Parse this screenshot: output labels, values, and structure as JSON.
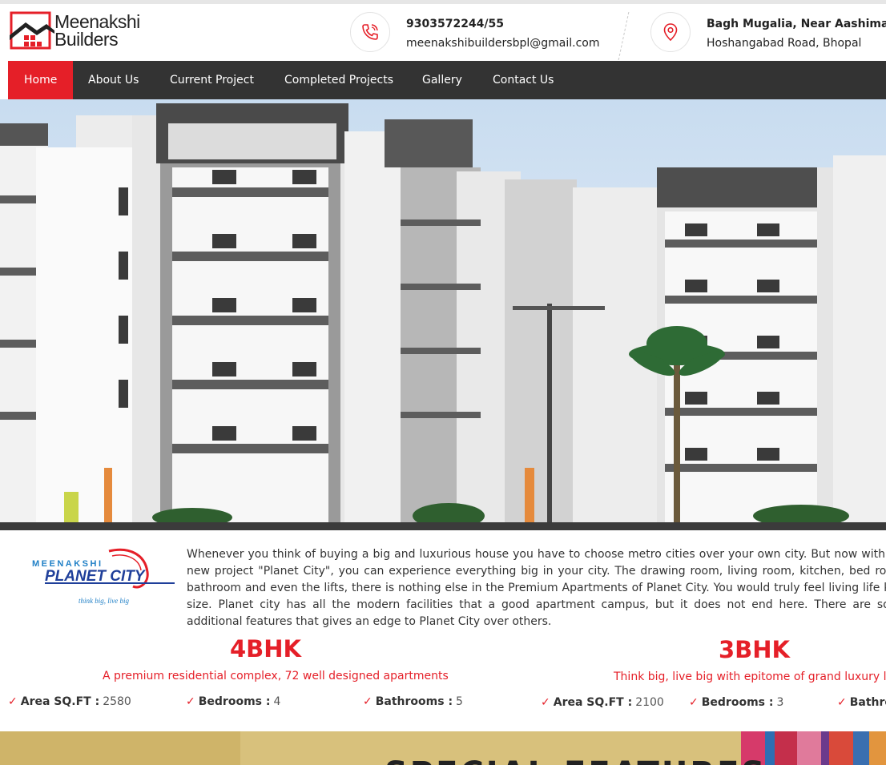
{
  "brand": {
    "name_line1": "Meenakshi",
    "name_line2": "Builders"
  },
  "contact": {
    "phone": "9303572244/55",
    "email": "meenakshibuildersbpl@gmail.com",
    "address_line1": "Bagh Mugalia, Near Aashima M",
    "address_line2": "Hoshangabad Road, Bhopal",
    "phone_icon": "phone-icon",
    "location_icon": "location-pin-icon"
  },
  "nav": {
    "items": [
      {
        "label": "Home",
        "active": true
      },
      {
        "label": "About Us"
      },
      {
        "label": "Current Project"
      },
      {
        "label": "Completed Projects"
      },
      {
        "label": "Gallery"
      },
      {
        "label": "Contact Us"
      }
    ]
  },
  "project_logo": {
    "line1": "MEENAKSHI",
    "line2": "PLANET CITY",
    "tagline": "think big, live big"
  },
  "intro_text": "Whenever you think of buying a big and luxurious house you have to choose metro cities over your own city. But now with the new project \"Planet City\", you can experience everything big in your city. The drawing room, living room, kitchen, bed room, bathroom and even the lifts, there is nothing else in the Premium Apartments of Planet City. You would truly feel living life king size. Planet city has all the modern facilities that a good apartment campus, but it does not end here. There are some additional features that gives an edge to Planet City over others.",
  "bhk": [
    {
      "title": "4BHK",
      "subtitle": "A premium residential complex, 72 well designed apartments",
      "area_label": "Area SQ.FT :",
      "area_value": "2580",
      "bedrooms_label": "Bedrooms :",
      "bedrooms_value": "4",
      "bathrooms_label": "Bathrooms :",
      "bathrooms_value": "5"
    },
    {
      "title": "3BHK",
      "subtitle": "Think big, live big with epitome of grand luxury living",
      "area_label": "Area SQ.FT :",
      "area_value": "2100",
      "bedrooms_label": "Bedrooms :",
      "bedrooms_value": "3",
      "bathrooms_label": "Bathro"
    }
  ],
  "section_title": "SPECIAL FEATURES",
  "colors": {
    "accent": "#e51f28",
    "nav_bg": "#333333"
  }
}
